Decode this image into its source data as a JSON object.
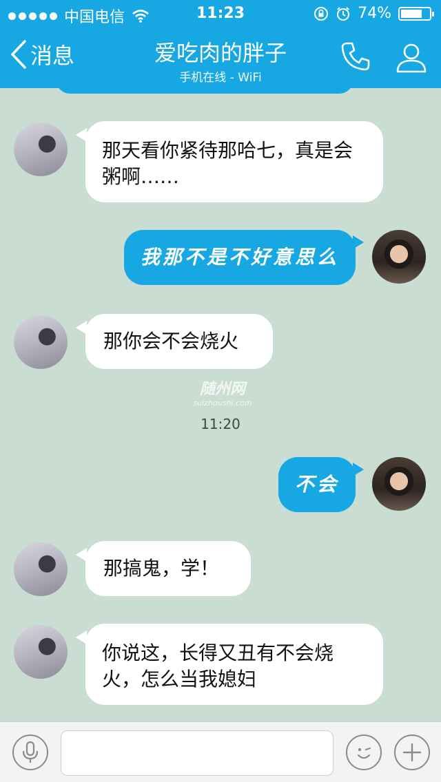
{
  "status_bar": {
    "carrier": "中国电信",
    "time": "11:23",
    "battery": "74%",
    "battery_level": 0.74
  },
  "nav": {
    "back_label": "消息",
    "title": "爱吃肉的胖子",
    "subtitle": "手机在线 - WiFi"
  },
  "messages": [
    {
      "side": "in",
      "text": "那天看你紧待那哈七，真是会粥啊……"
    },
    {
      "side": "out",
      "text": "我那不是不好意思么"
    },
    {
      "side": "in",
      "text": "那你会不会烧火"
    },
    {
      "side": "out",
      "text": "不会"
    },
    {
      "side": "in",
      "text": "那搞鬼，学！"
    },
    {
      "side": "in",
      "text": "你说这，长得又丑有不会烧火，怎么当我媳妇"
    }
  ],
  "time_separator": "11:20",
  "watermark": {
    "main": "随州网",
    "sub": "suizhoushi.com"
  },
  "input": {
    "value": "",
    "placeholder": ""
  },
  "colors": {
    "accent": "#17a8e3",
    "chat_bg": "#c9ddd3",
    "bubble_in": "#ffffff"
  }
}
